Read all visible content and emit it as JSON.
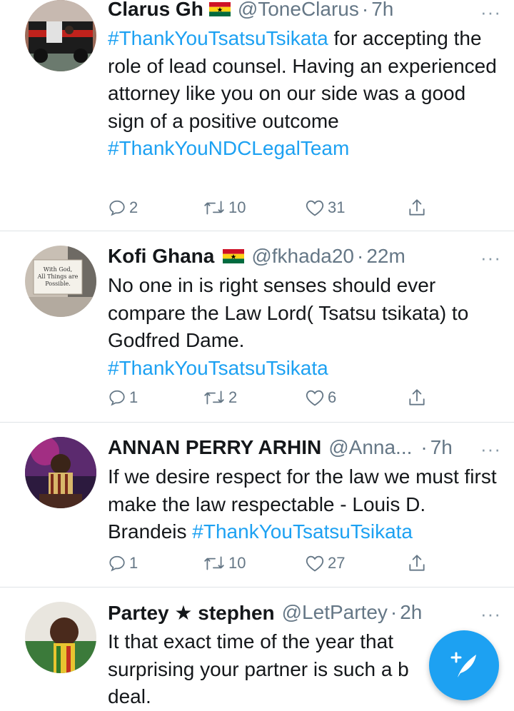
{
  "tweets": [
    {
      "name": "Clarus Gh",
      "flag": "ghana-flag",
      "handle": "@ToneClarus",
      "dot": "·",
      "time": "7h",
      "body": [
        {
          "text": "#ThankYouTsatsuTsikata",
          "tag": true
        },
        {
          "text": " for accepting the role of lead counsel. Having an experienced attorney like you on our side was a good sign of a positive outcome",
          "tag": false
        },
        {
          "text": "#ThankYouNDCLegalTeam",
          "tag": true,
          "block": true
        }
      ],
      "replies": "2",
      "retweets": "10",
      "likes": "31"
    },
    {
      "name": "Kofi Ghana",
      "flag": "ghana-flag",
      "handle": "@fkhada20",
      "dot": "·",
      "time": "22m",
      "avatar_text": "With God, All Things are Possible.",
      "body": [
        {
          "text": "No one in is right senses should ever compare the Law Lord( Tsatsu tsikata) to Godfred Dame.",
          "tag": false
        },
        {
          "text": "#ThankYouTsatsuTsikata",
          "tag": true,
          "block": true
        }
      ],
      "replies": "1",
      "retweets": "2",
      "likes": "6"
    },
    {
      "name": "ANNAN PERRY ARHIN",
      "handle": "@Anna...",
      "dot": "·",
      "time": "7h",
      "body": [
        {
          "text": "If we desire respect for the law we must first make the law respectable - Louis D. Brandeis ",
          "tag": false
        },
        {
          "text": "#ThankYouTsatsuTsikata",
          "tag": true
        }
      ],
      "replies": "1",
      "retweets": "10",
      "likes": "27"
    },
    {
      "name": "Partey ★ stephen",
      "handle": "@LetPartey",
      "dot": "·",
      "time": "2h",
      "body": [
        {
          "text": "It that exact time of the year that surprising your partner is such a b",
          "tag": false
        },
        {
          "text": "deal.",
          "tag": false,
          "block": true
        }
      ]
    }
  ],
  "more_label": "···",
  "icons": {
    "reply": "reply-icon",
    "retweet": "retweet-icon",
    "like": "heart-icon",
    "share": "share-icon",
    "compose": "compose-tweet-icon"
  },
  "colors": {
    "accent": "#1da1f2",
    "secondary_text": "#657786",
    "divider": "#dfe3e6"
  }
}
